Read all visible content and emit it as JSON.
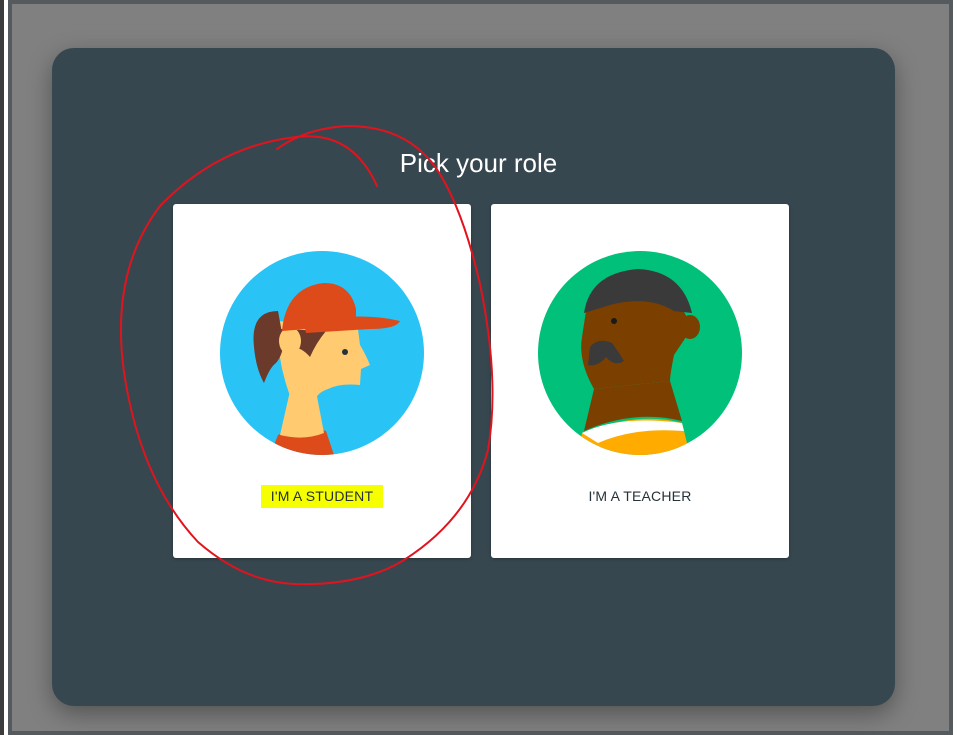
{
  "dialog": {
    "title": "Pick your role"
  },
  "roles": [
    {
      "label": "I'M A STUDENT",
      "icon": "student-avatar-icon",
      "highlighted": true
    },
    {
      "label": "I'M A TEACHER",
      "icon": "teacher-avatar-icon",
      "highlighted": false
    }
  ],
  "colors": {
    "backdrop": "#808080",
    "dialog": "#37474f",
    "card": "#ffffff",
    "student_circle": "#29c3f6",
    "teacher_circle": "#00c07a",
    "highlight": "#f6ff00",
    "annotation_stroke": "#e0141e"
  }
}
